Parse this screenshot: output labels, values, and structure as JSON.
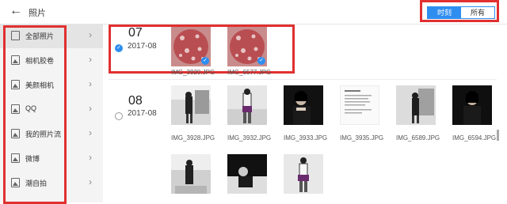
{
  "header": {
    "back_icon": "←",
    "title": "照片"
  },
  "view_toggle": {
    "time_label": "时刻",
    "all_label": "所有",
    "accent": "#2e8ef0"
  },
  "sidebar": {
    "items": [
      {
        "label": "全部照片",
        "icon": "document-icon",
        "arrow": "›",
        "active": true
      },
      {
        "label": "相机胶卷",
        "icon": "image-icon",
        "arrow": "›"
      },
      {
        "label": "美颜相机",
        "icon": "image-icon",
        "arrow": "›"
      },
      {
        "label": "QQ",
        "icon": "image-icon",
        "arrow": "›"
      },
      {
        "label": "我的照片流",
        "icon": "image-icon",
        "arrow": "›"
      },
      {
        "label": "微博",
        "icon": "image-icon",
        "arrow": "›"
      },
      {
        "label": "潮自拍",
        "icon": "image-icon",
        "arrow": "›"
      }
    ]
  },
  "groups": [
    {
      "month": "07",
      "date": "2017-08",
      "selected": true,
      "photos": [
        {
          "name": "IMG_3920.JPG",
          "selected": true
        },
        {
          "name": "IMG_6577.JPG",
          "selected": true
        }
      ]
    },
    {
      "month": "08",
      "date": "2017-08",
      "selected": false,
      "photos": [
        {
          "name": "IMG_3928.JPG"
        },
        {
          "name": "IMG_3932.JPG"
        },
        {
          "name": "IMG_3933.JPG"
        },
        {
          "name": "IMG_3935.JPG"
        },
        {
          "name": "IMG_6589.JPG"
        },
        {
          "name": "IMG_6594.JPG"
        },
        {
          "name": ""
        },
        {
          "name": ""
        },
        {
          "name": ""
        }
      ]
    }
  ],
  "check_glyph": "✓"
}
